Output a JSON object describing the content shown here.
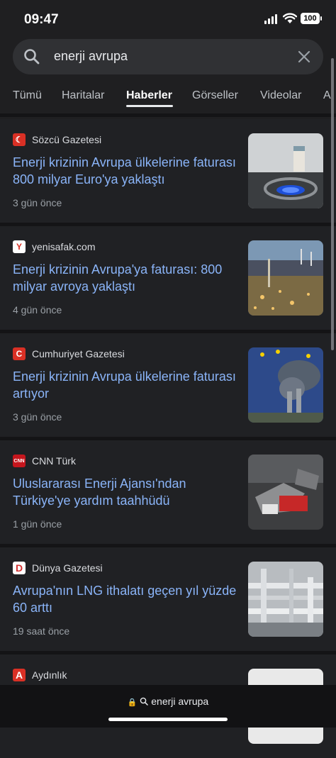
{
  "status_bar": {
    "time": "09:47",
    "battery": "100"
  },
  "search": {
    "query": "enerji avrupa"
  },
  "tabs": [
    {
      "label": "Tümü"
    },
    {
      "label": "Haritalar"
    },
    {
      "label": "Haberler",
      "active": true
    },
    {
      "label": "Görseller"
    },
    {
      "label": "Videolar"
    },
    {
      "label": "A"
    }
  ],
  "results": [
    {
      "source": "Sözcü Gazetesi",
      "logo_text": "☾",
      "logo_color": "#d93025",
      "headline": "Enerji krizinin Avrupa ülkelerine faturası 800 milyar Euro'ya yaklaştı",
      "ago": "3 gün önce"
    },
    {
      "source": "yenisafak.com",
      "logo_text": "Y",
      "logo_color": "#d93025",
      "headline": "Enerji krizinin Avrupa'ya faturası: 800 milyar avroya yaklaştı",
      "ago": "4 gün önce"
    },
    {
      "source": "Cumhuriyet Gazetesi",
      "logo_text": "C",
      "logo_color": "#d93025",
      "headline": "Enerji krizinin Avrupa ülkelerine faturası artıyor",
      "ago": "3 gün önce"
    },
    {
      "source": "CNN Türk",
      "logo_text": "CNN",
      "logo_color": "#c5161d",
      "headline": "Uluslararası Enerji Ajansı'ndan Türkiye'ye yardım taahhüdü",
      "ago": "1 gün önce"
    },
    {
      "source": "Dünya Gazetesi",
      "logo_text": "D",
      "logo_color": "#d32f2f",
      "headline": "Avrupa'nın LNG ithalatı geçen yıl yüzde 60 arttı",
      "ago": "19 saat önce"
    },
    {
      "source": "Aydınlık",
      "logo_text": "A",
      "logo_color": "#d93025",
      "headline": "",
      "ago": ""
    }
  ],
  "url_bar": {
    "text": "enerji avrupa"
  }
}
